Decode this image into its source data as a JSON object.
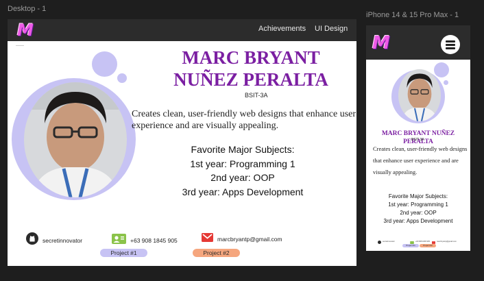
{
  "frames": {
    "desktop_label": "Desktop - 1",
    "phone_label": "iPhone 14 & 15 Pro Max - 1"
  },
  "brand": {
    "logo": "M"
  },
  "nav": {
    "achievements": "Achievements",
    "ui_design": "UI Design"
  },
  "profile": {
    "name": "MARC BRYANT NUÑEZ PERALTA",
    "section": "BSIT-3A",
    "description": "Creates clean, user-friendly web designs that enhance user experience and are visually appealing.",
    "subjects_title": "Favorite Major Subjects:",
    "subjects": [
      "1st year: Programming 1",
      "2nd year: OOP",
      "3rd year: Apps Development"
    ]
  },
  "contacts": {
    "github": "secretinnovator",
    "phone": "+63 908 1845 905",
    "email": "marcbryantp@gmail.com"
  },
  "projects": [
    "Project  #1",
    "Project #2"
  ],
  "icons": {
    "github": "github-icon",
    "phone": "contact-card-icon",
    "email": "mail-icon",
    "menu": "hamburger-menu-icon"
  },
  "colors": {
    "accent": "#7b1fa2",
    "lavender": "#c7c3f4",
    "peach": "#f5a67e",
    "nav": "#2c2c2c",
    "canvas": "#1e1e1e"
  }
}
